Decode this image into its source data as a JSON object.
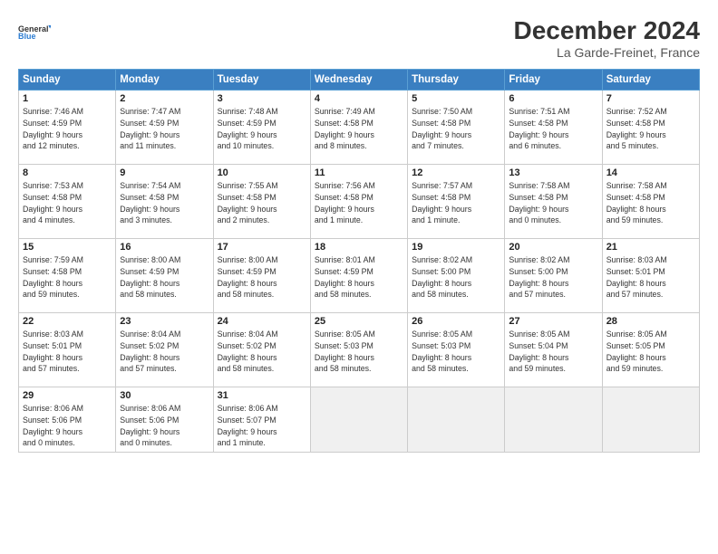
{
  "header": {
    "logo_line1": "General",
    "logo_line2": "Blue",
    "month": "December 2024",
    "location": "La Garde-Freinet, France"
  },
  "weekdays": [
    "Sunday",
    "Monday",
    "Tuesday",
    "Wednesday",
    "Thursday",
    "Friday",
    "Saturday"
  ],
  "weeks": [
    [
      {
        "day": "1",
        "info": "Sunrise: 7:46 AM\nSunset: 4:59 PM\nDaylight: 9 hours\nand 12 minutes."
      },
      {
        "day": "2",
        "info": "Sunrise: 7:47 AM\nSunset: 4:59 PM\nDaylight: 9 hours\nand 11 minutes."
      },
      {
        "day": "3",
        "info": "Sunrise: 7:48 AM\nSunset: 4:59 PM\nDaylight: 9 hours\nand 10 minutes."
      },
      {
        "day": "4",
        "info": "Sunrise: 7:49 AM\nSunset: 4:58 PM\nDaylight: 9 hours\nand 8 minutes."
      },
      {
        "day": "5",
        "info": "Sunrise: 7:50 AM\nSunset: 4:58 PM\nDaylight: 9 hours\nand 7 minutes."
      },
      {
        "day": "6",
        "info": "Sunrise: 7:51 AM\nSunset: 4:58 PM\nDaylight: 9 hours\nand 6 minutes."
      },
      {
        "day": "7",
        "info": "Sunrise: 7:52 AM\nSunset: 4:58 PM\nDaylight: 9 hours\nand 5 minutes."
      }
    ],
    [
      {
        "day": "8",
        "info": "Sunrise: 7:53 AM\nSunset: 4:58 PM\nDaylight: 9 hours\nand 4 minutes."
      },
      {
        "day": "9",
        "info": "Sunrise: 7:54 AM\nSunset: 4:58 PM\nDaylight: 9 hours\nand 3 minutes."
      },
      {
        "day": "10",
        "info": "Sunrise: 7:55 AM\nSunset: 4:58 PM\nDaylight: 9 hours\nand 2 minutes."
      },
      {
        "day": "11",
        "info": "Sunrise: 7:56 AM\nSunset: 4:58 PM\nDaylight: 9 hours\nand 1 minute."
      },
      {
        "day": "12",
        "info": "Sunrise: 7:57 AM\nSunset: 4:58 PM\nDaylight: 9 hours\nand 1 minute."
      },
      {
        "day": "13",
        "info": "Sunrise: 7:58 AM\nSunset: 4:58 PM\nDaylight: 9 hours\nand 0 minutes."
      },
      {
        "day": "14",
        "info": "Sunrise: 7:58 AM\nSunset: 4:58 PM\nDaylight: 8 hours\nand 59 minutes."
      }
    ],
    [
      {
        "day": "15",
        "info": "Sunrise: 7:59 AM\nSunset: 4:58 PM\nDaylight: 8 hours\nand 59 minutes."
      },
      {
        "day": "16",
        "info": "Sunrise: 8:00 AM\nSunset: 4:59 PM\nDaylight: 8 hours\nand 58 minutes."
      },
      {
        "day": "17",
        "info": "Sunrise: 8:00 AM\nSunset: 4:59 PM\nDaylight: 8 hours\nand 58 minutes."
      },
      {
        "day": "18",
        "info": "Sunrise: 8:01 AM\nSunset: 4:59 PM\nDaylight: 8 hours\nand 58 minutes."
      },
      {
        "day": "19",
        "info": "Sunrise: 8:02 AM\nSunset: 5:00 PM\nDaylight: 8 hours\nand 58 minutes."
      },
      {
        "day": "20",
        "info": "Sunrise: 8:02 AM\nSunset: 5:00 PM\nDaylight: 8 hours\nand 57 minutes."
      },
      {
        "day": "21",
        "info": "Sunrise: 8:03 AM\nSunset: 5:01 PM\nDaylight: 8 hours\nand 57 minutes."
      }
    ],
    [
      {
        "day": "22",
        "info": "Sunrise: 8:03 AM\nSunset: 5:01 PM\nDaylight: 8 hours\nand 57 minutes."
      },
      {
        "day": "23",
        "info": "Sunrise: 8:04 AM\nSunset: 5:02 PM\nDaylight: 8 hours\nand 57 minutes."
      },
      {
        "day": "24",
        "info": "Sunrise: 8:04 AM\nSunset: 5:02 PM\nDaylight: 8 hours\nand 58 minutes."
      },
      {
        "day": "25",
        "info": "Sunrise: 8:05 AM\nSunset: 5:03 PM\nDaylight: 8 hours\nand 58 minutes."
      },
      {
        "day": "26",
        "info": "Sunrise: 8:05 AM\nSunset: 5:03 PM\nDaylight: 8 hours\nand 58 minutes."
      },
      {
        "day": "27",
        "info": "Sunrise: 8:05 AM\nSunset: 5:04 PM\nDaylight: 8 hours\nand 59 minutes."
      },
      {
        "day": "28",
        "info": "Sunrise: 8:05 AM\nSunset: 5:05 PM\nDaylight: 8 hours\nand 59 minutes."
      }
    ],
    [
      {
        "day": "29",
        "info": "Sunrise: 8:06 AM\nSunset: 5:06 PM\nDaylight: 9 hours\nand 0 minutes."
      },
      {
        "day": "30",
        "info": "Sunrise: 8:06 AM\nSunset: 5:06 PM\nDaylight: 9 hours\nand 0 minutes."
      },
      {
        "day": "31",
        "info": "Sunrise: 8:06 AM\nSunset: 5:07 PM\nDaylight: 9 hours\nand 1 minute."
      },
      {
        "day": "",
        "info": ""
      },
      {
        "day": "",
        "info": ""
      },
      {
        "day": "",
        "info": ""
      },
      {
        "day": "",
        "info": ""
      }
    ]
  ]
}
